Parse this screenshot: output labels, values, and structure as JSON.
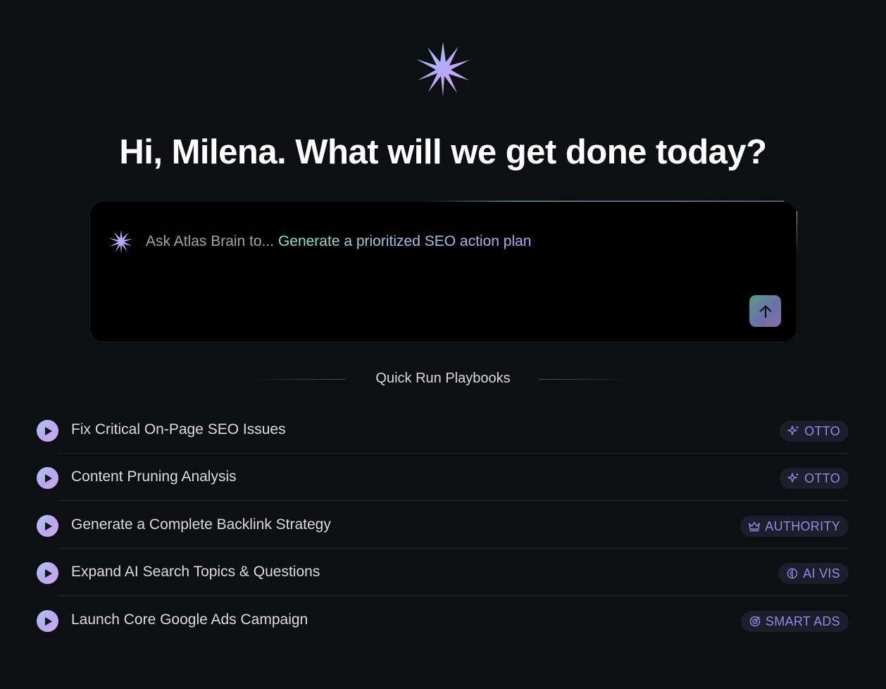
{
  "greeting": "Hi, Milena. What will we get done today?",
  "logo_icon": "sparkle-star-icon",
  "prompt": {
    "prefix": "Ask Atlas Brain to...",
    "suggestion": "Generate a prioritized SEO action plan",
    "icon": "sparkle-star-icon",
    "send_icon": "arrow-up-icon"
  },
  "quick_run": {
    "heading": "Quick Run Playbooks",
    "items": [
      {
        "title": "Fix Critical On-Page SEO Issues",
        "badge": "OTTO",
        "badge_icon": "sparkles-icon"
      },
      {
        "title": "Content Pruning Analysis",
        "badge": "OTTO",
        "badge_icon": "sparkles-icon"
      },
      {
        "title": "Generate a Complete Backlink Strategy",
        "badge": "AUTHORITY",
        "badge_icon": "crown-icon"
      },
      {
        "title": "Expand AI Search Topics & Questions",
        "badge": "AI VIS",
        "badge_icon": "brain-icon"
      },
      {
        "title": "Launch Core Google Ads Campaign",
        "badge": "SMART ADS",
        "badge_icon": "target-icon"
      }
    ]
  },
  "colors": {
    "background": "#0e0f13",
    "prompt_bg": "#000000",
    "badge_text": "#9b86e6",
    "badge_bg": "#1d1e2b",
    "accent_gradient_start": "#8ee6c4",
    "accent_gradient_end": "#b8a6f2"
  }
}
